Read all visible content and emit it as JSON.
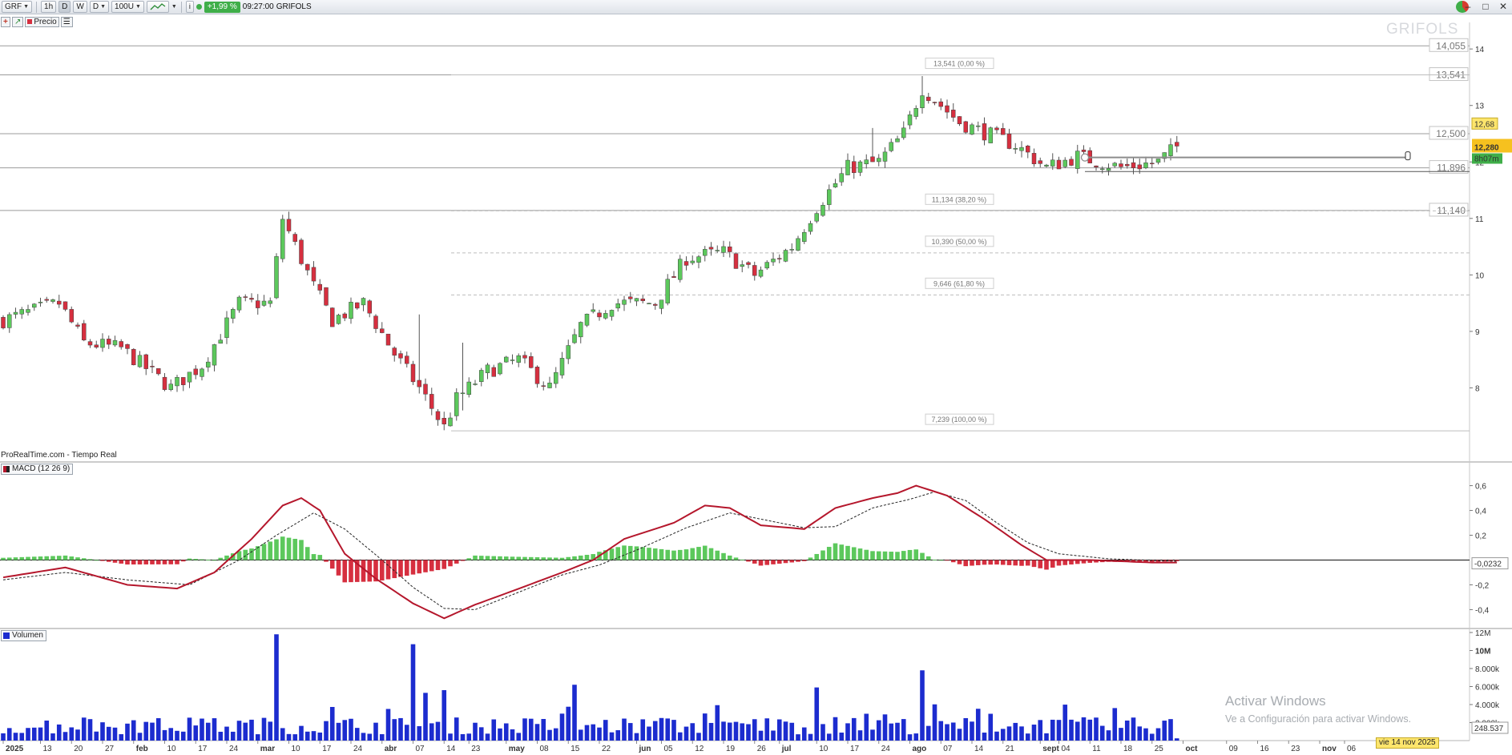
{
  "toolbar": {
    "ticker": "GRF",
    "intervals": [
      "1h",
      "D",
      "W"
    ],
    "timeframe": "D",
    "units": "100U",
    "change": "+1,99 %",
    "time": "09:27:00",
    "name": "GRIFOLS"
  },
  "subbar": {
    "price_label": "Precio"
  },
  "watermark": "GRIFOLS",
  "source": "ProRealTime.com - Tiempo Real",
  "macd_label": "MACD (12 26 9)",
  "volume_label": "Volumen",
  "windows_notice": {
    "line1": "Activar Windows",
    "line2": "Ve a Configuración para activar Windows."
  },
  "date_tooltip": "vie 14 nov 2025",
  "colors": {
    "up": "#5cc85c",
    "down": "#d62f3f",
    "volume": "#1c2ccf",
    "macd": "#b5172c",
    "last": "#f6c11f",
    "badge": "#3fae49"
  },
  "chart_data": [
    {
      "type": "candlestick",
      "title": "GRIFOLS",
      "ylim": [
        7.0,
        14.3
      ],
      "yticks": [
        8,
        9,
        10,
        11,
        12,
        13,
        14
      ],
      "last_price": "12,280",
      "countdown": "8h07m",
      "price_marker": "12,68",
      "levels": [
        {
          "label": "14,055",
          "value": 14.055
        },
        {
          "label": "13,541",
          "value": 13.541
        },
        {
          "label": "12,500",
          "value": 12.5
        },
        {
          "label": "11,896",
          "value": 11.896
        },
        {
          "label": "11,140",
          "value": 11.14
        }
      ],
      "fibonacci": [
        {
          "label": "13,541 (0,00 %)",
          "value": 13.541
        },
        {
          "label": "11,134 (38,20 %)",
          "value": 11.134
        },
        {
          "label": "10,390 (50,00 %)",
          "value": 10.39
        },
        {
          "label": "9,646 (61,80 %)",
          "value": 9.646
        },
        {
          "label": "7,239 (100,00 %)",
          "value": 7.239
        }
      ],
      "x_labels": [
        {
          "label": "2025",
          "bold": true,
          "idx": 0
        },
        {
          "label": "13",
          "idx": 6
        },
        {
          "label": "20",
          "idx": 11
        },
        {
          "label": "27",
          "idx": 16
        },
        {
          "label": "feb",
          "bold": true,
          "idx": 21
        },
        {
          "label": "10",
          "idx": 26
        },
        {
          "label": "17",
          "idx": 31
        },
        {
          "label": "24",
          "idx": 36
        },
        {
          "label": "mar",
          "bold": true,
          "idx": 41
        },
        {
          "label": "10",
          "idx": 46
        },
        {
          "label": "17",
          "idx": 51
        },
        {
          "label": "24",
          "idx": 56
        },
        {
          "label": "abr",
          "bold": true,
          "idx": 61
        },
        {
          "label": "07",
          "idx": 66
        },
        {
          "label": "14",
          "idx": 71
        },
        {
          "label": "23",
          "idx": 75
        },
        {
          "label": "may",
          "bold": true,
          "idx": 81
        },
        {
          "label": "08",
          "idx": 86
        },
        {
          "label": "15",
          "idx": 91
        },
        {
          "label": "22",
          "idx": 96
        },
        {
          "label": "jun",
          "bold": true,
          "idx": 102
        },
        {
          "label": "05",
          "idx": 106
        },
        {
          "label": "12",
          "idx": 111
        },
        {
          "label": "19",
          "idx": 116
        },
        {
          "label": "26",
          "idx": 121
        },
        {
          "label": "jul",
          "bold": true,
          "idx": 125
        },
        {
          "label": "10",
          "idx": 131
        },
        {
          "label": "17",
          "idx": 136
        },
        {
          "label": "24",
          "idx": 141
        },
        {
          "label": "ago",
          "bold": true,
          "idx": 146
        },
        {
          "label": "07",
          "idx": 151
        },
        {
          "label": "14",
          "idx": 156
        },
        {
          "label": "21",
          "idx": 161
        },
        {
          "label": "sept",
          "bold": true,
          "idx": 167
        },
        {
          "label": "04",
          "idx": 170
        },
        {
          "label": "11",
          "idx": 175
        },
        {
          "label": "18",
          "idx": 180
        },
        {
          "label": "25",
          "idx": 185
        },
        {
          "label": "oct",
          "bold": true,
          "idx": 190
        },
        {
          "label": "09",
          "idx": 197
        },
        {
          "label": "16",
          "idx": 202
        },
        {
          "label": "23",
          "idx": 207
        },
        {
          "label": "nov",
          "bold": true,
          "idx": 212
        },
        {
          "label": "06",
          "idx": 216
        }
      ],
      "anchors": [
        [
          0,
          9.2
        ],
        [
          9,
          9.5
        ],
        [
          13,
          8.8
        ],
        [
          19,
          8.7
        ],
        [
          27,
          8.0
        ],
        [
          32,
          8.4
        ],
        [
          38,
          9.5
        ],
        [
          43,
          9.5
        ],
        [
          45,
          11.0
        ],
        [
          50,
          9.8
        ],
        [
          53,
          9.2
        ],
        [
          58,
          9.5
        ],
        [
          63,
          8.6
        ],
        [
          67,
          8.0
        ],
        [
          71,
          7.3
        ],
        [
          73,
          7.8
        ],
        [
          78,
          8.3
        ],
        [
          83,
          8.5
        ],
        [
          88,
          8.0
        ],
        [
          93,
          9.1
        ],
        [
          98,
          9.5
        ],
        [
          105,
          9.5
        ],
        [
          110,
          10.3
        ],
        [
          116,
          10.4
        ],
        [
          121,
          10.0
        ],
        [
          127,
          10.5
        ],
        [
          131,
          11.2
        ],
        [
          136,
          11.9
        ],
        [
          141,
          12.0
        ],
        [
          145,
          12.5
        ],
        [
          148,
          13.3
        ],
        [
          154,
          12.7
        ],
        [
          163,
          12.3
        ],
        [
          168,
          11.9
        ],
        [
          173,
          12.1
        ],
        [
          180,
          11.9
        ],
        [
          186,
          12.0
        ],
        [
          189,
          12.28
        ]
      ],
      "spikes": [
        {
          "i": 46,
          "high": 11.12
        },
        {
          "i": 67,
          "high": 9.3,
          "low": 7.9
        },
        {
          "i": 71,
          "low": 7.25
        },
        {
          "i": 74,
          "high": 8.8,
          "low": 7.6
        },
        {
          "i": 148,
          "high": 13.52
        },
        {
          "i": 140,
          "high": 12.6
        }
      ],
      "candle_count": 190
    },
    {
      "type": "line",
      "title": "MACD (12 26 9)",
      "ylim": [
        -0.52,
        0.72
      ],
      "yticks": [
        {
          "label": "0,6",
          "value": 0.6
        },
        {
          "label": "0,4",
          "value": 0.4
        },
        {
          "label": "0,2",
          "value": 0.2
        },
        {
          "label": "-0,2",
          "value": -0.2
        },
        {
          "label": "-0,4",
          "value": -0.4
        }
      ],
      "last_macd_label": "-0,0232",
      "series": [
        {
          "name": "MACD",
          "anchors": [
            [
              0,
              -0.14
            ],
            [
              10,
              -0.06
            ],
            [
              20,
              -0.2
            ],
            [
              28,
              -0.23
            ],
            [
              34,
              -0.1
            ],
            [
              40,
              0.17
            ],
            [
              45,
              0.44
            ],
            [
              48,
              0.5
            ],
            [
              51,
              0.4
            ],
            [
              55,
              0.05
            ],
            [
              60,
              -0.15
            ],
            [
              66,
              -0.35
            ],
            [
              71,
              -0.47
            ],
            [
              76,
              -0.36
            ],
            [
              82,
              -0.25
            ],
            [
              90,
              -0.1
            ],
            [
              95,
              0.0
            ],
            [
              100,
              0.17
            ],
            [
              108,
              0.3
            ],
            [
              113,
              0.44
            ],
            [
              117,
              0.42
            ],
            [
              122,
              0.28
            ],
            [
              129,
              0.25
            ],
            [
              134,
              0.42
            ],
            [
              140,
              0.5
            ],
            [
              144,
              0.54
            ],
            [
              147,
              0.6
            ],
            [
              152,
              0.52
            ],
            [
              158,
              0.33
            ],
            [
              164,
              0.12
            ],
            [
              168,
              0.0
            ],
            [
              175,
              0.0
            ],
            [
              185,
              -0.02
            ],
            [
              189,
              -0.02
            ]
          ]
        },
        {
          "name": "Signal",
          "anchors": [
            [
              0,
              -0.16
            ],
            [
              10,
              -0.1
            ],
            [
              20,
              -0.16
            ],
            [
              30,
              -0.2
            ],
            [
              38,
              0.0
            ],
            [
              44,
              0.2
            ],
            [
              50,
              0.38
            ],
            [
              55,
              0.25
            ],
            [
              61,
              0.0
            ],
            [
              66,
              -0.22
            ],
            [
              71,
              -0.39
            ],
            [
              76,
              -0.4
            ],
            [
              82,
              -0.28
            ],
            [
              90,
              -0.12
            ],
            [
              96,
              -0.04
            ],
            [
              102,
              0.08
            ],
            [
              110,
              0.26
            ],
            [
              117,
              0.38
            ],
            [
              122,
              0.33
            ],
            [
              129,
              0.26
            ],
            [
              134,
              0.27
            ],
            [
              140,
              0.42
            ],
            [
              146,
              0.49
            ],
            [
              150,
              0.55
            ],
            [
              155,
              0.48
            ],
            [
              160,
              0.3
            ],
            [
              165,
              0.14
            ],
            [
              170,
              0.05
            ],
            [
              178,
              0.01
            ],
            [
              189,
              -0.01
            ]
          ]
        }
      ]
    },
    {
      "type": "bar",
      "title": "Volumen",
      "ylim": [
        0,
        12000000
      ],
      "yticks": [
        {
          "label": "12M",
          "value": 12000000
        },
        {
          "label": "10M",
          "value": 10000000,
          "bold": true
        },
        {
          "label": "8.000k",
          "value": 8000000
        },
        {
          "label": "6.000k",
          "value": 6000000
        },
        {
          "label": "4.000k",
          "value": 4000000
        },
        {
          "label": "2.000k",
          "value": 2000000
        }
      ],
      "last_volume_label": "248.537",
      "spikes": [
        {
          "i": 44,
          "value": 11800000
        },
        {
          "i": 66,
          "value": 10700000
        },
        {
          "i": 148,
          "value": 7800000
        },
        {
          "i": 92,
          "value": 6200000
        },
        {
          "i": 131,
          "value": 5900000
        },
        {
          "i": 71,
          "value": 5600000
        },
        {
          "i": 68,
          "value": 5300000
        }
      ]
    }
  ]
}
